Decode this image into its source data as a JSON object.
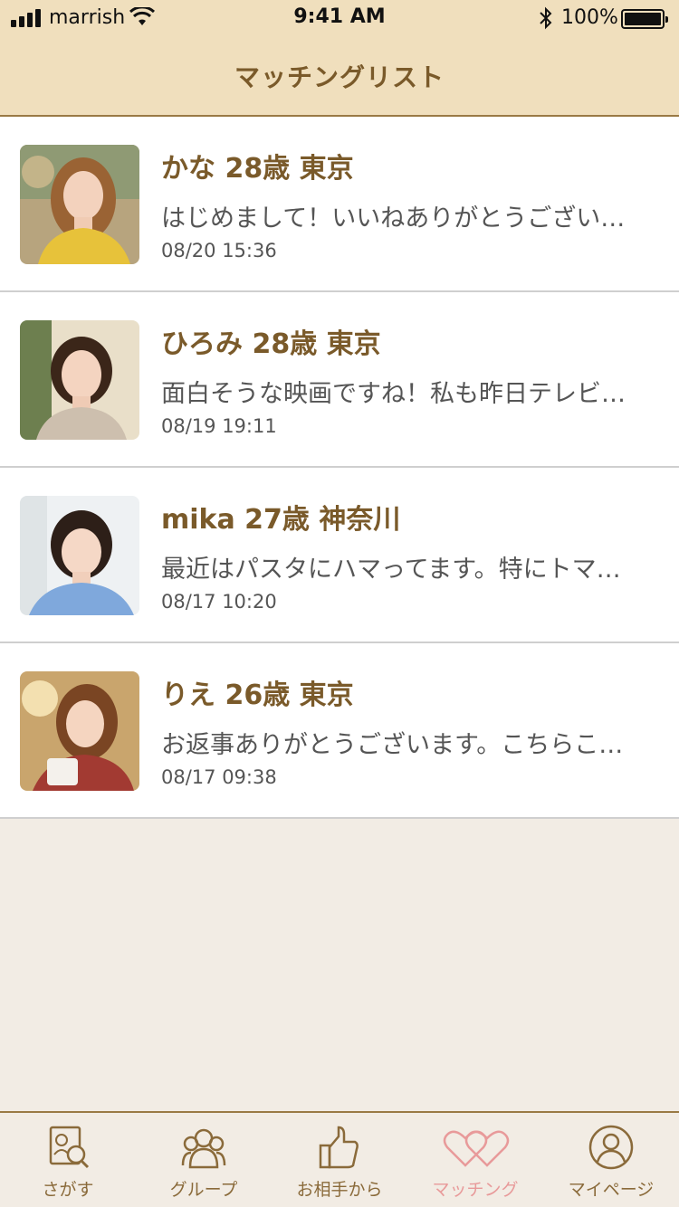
{
  "status_bar": {
    "carrier": "marrish",
    "time": "9:41 AM",
    "battery": "100%"
  },
  "header": {
    "title": "マッチングリスト"
  },
  "matches": [
    {
      "name": "かな 28歳 東京",
      "message": "はじめまして！いいねありがとうござい…",
      "time": "08/20 15:36"
    },
    {
      "name": "ひろみ 28歳 東京",
      "message": "面白そうな映画ですね！私も昨日テレビ…",
      "time": "08/19 19:11"
    },
    {
      "name": "mika 27歳 神奈川",
      "message": "最近はパスタにハマってます。特にトマ…",
      "time": "08/17 10:20"
    },
    {
      "name": "りえ 26歳 東京",
      "message": "お返事ありがとうございます。こちらこ…",
      "time": "08/17 09:38"
    }
  ],
  "tabbar": {
    "items": [
      {
        "label": "さがす",
        "icon": "search-profile-icon"
      },
      {
        "label": "グループ",
        "icon": "group-icon"
      },
      {
        "label": "お相手から",
        "icon": "thumbs-up-icon"
      },
      {
        "label": "マッチング",
        "icon": "hearts-icon",
        "active": true
      },
      {
        "label": "マイページ",
        "icon": "user-icon"
      }
    ],
    "active_color": "#e89a9a",
    "inactive_color": "#8a6a3a"
  },
  "colors": {
    "header_bg": "#f0dfbd",
    "accent_brown": "#7a5a2a",
    "page_bg": "#f2ece4"
  }
}
